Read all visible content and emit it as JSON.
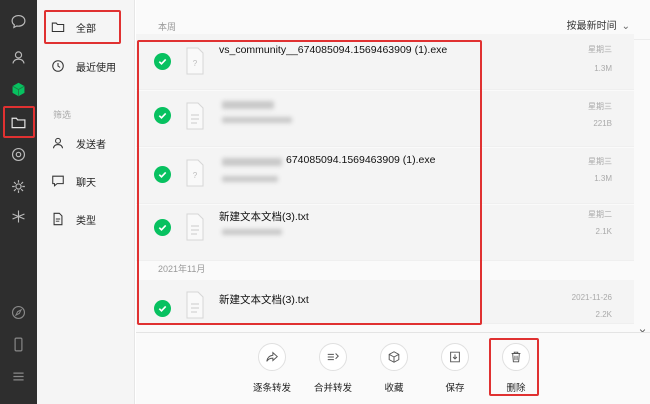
{
  "sidebar": {
    "items": [
      {
        "label": "全部"
      },
      {
        "label": "最近使用"
      }
    ],
    "group_label": "筛选",
    "filters": [
      {
        "label": "发送者"
      },
      {
        "label": "聊天"
      },
      {
        "label": "类型"
      }
    ]
  },
  "header": {
    "section": "本周",
    "sort_label": "按最新时间",
    "sort_chevron": "⌄"
  },
  "files": [
    {
      "name": "vs_community__674085094.1569463909 (1).exe",
      "day": "星期三",
      "size": "1.3M"
    },
    {
      "name": "",
      "day": "星期三",
      "size": "221B"
    },
    {
      "name": "674085094.1569463909 (1).exe",
      "day": "星期三",
      "size": "1.3M"
    },
    {
      "name": "新建文本文档(3).txt",
      "day": "星期二",
      "size": "2.1K"
    }
  ],
  "older_section": "2021年11月",
  "older_files": [
    {
      "name": "新建文本文档(3).txt",
      "date": "2021-11-26",
      "size": "2.2K"
    }
  ],
  "actions": [
    {
      "label": "逐条转发"
    },
    {
      "label": "合并转发"
    },
    {
      "label": "收藏"
    },
    {
      "label": "保存"
    },
    {
      "label": "删除"
    }
  ],
  "close_glyph": "×",
  "colors": {
    "accent_green": "#07c160",
    "highlight_red": "#e03131",
    "rail_bg": "#2e2e2e"
  }
}
